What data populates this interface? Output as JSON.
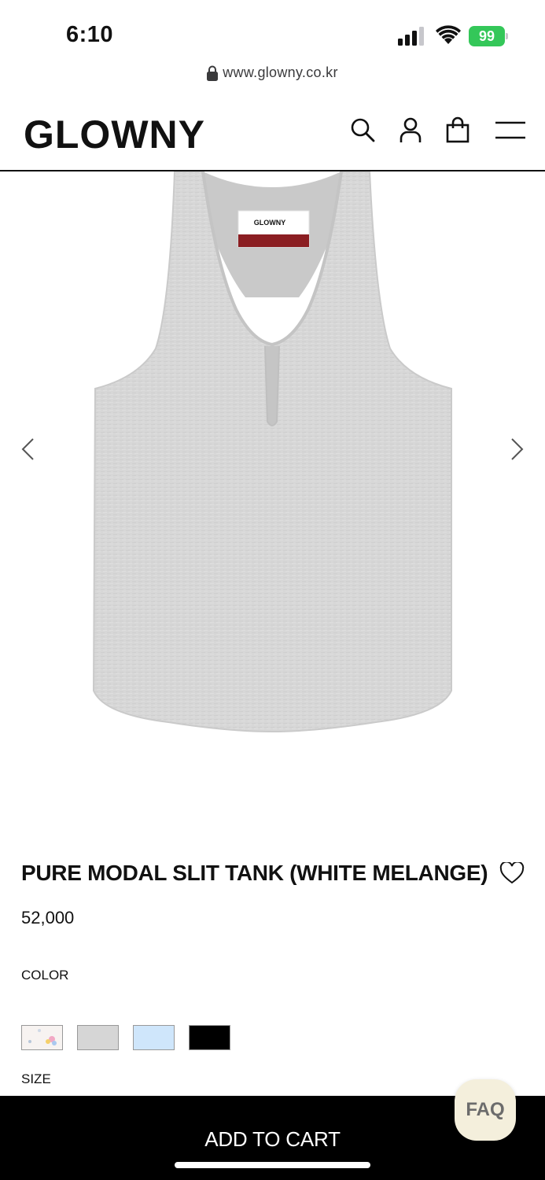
{
  "status_bar": {
    "time": "6:10",
    "battery": "99",
    "battery_color": "#34c759"
  },
  "browser": {
    "url": "www.glowny.co.kr"
  },
  "header": {
    "logo": "GLOWNY",
    "icons": [
      "search-icon",
      "user-icon",
      "shopping-bag-icon",
      "menu-icon"
    ]
  },
  "product": {
    "image_alt": "grey racerback tank top with slit neckline",
    "tag_brand": "GLOWNY",
    "title": "PURE MODAL SLIT TANK (WHITE MELANGE)",
    "price": "52,000",
    "color_label": "COLOR",
    "size_label": "SIZE",
    "swatches": [
      {
        "name": "floral",
        "color": "#f7f3f1"
      },
      {
        "name": "melange grey",
        "color": "#d6d6d6"
      },
      {
        "name": "light blue",
        "color": "#cfe6fb"
      },
      {
        "name": "black",
        "color": "#000000"
      }
    ]
  },
  "actions": {
    "add_to_cart": "ADD TO CART",
    "faq": "FAQ"
  }
}
